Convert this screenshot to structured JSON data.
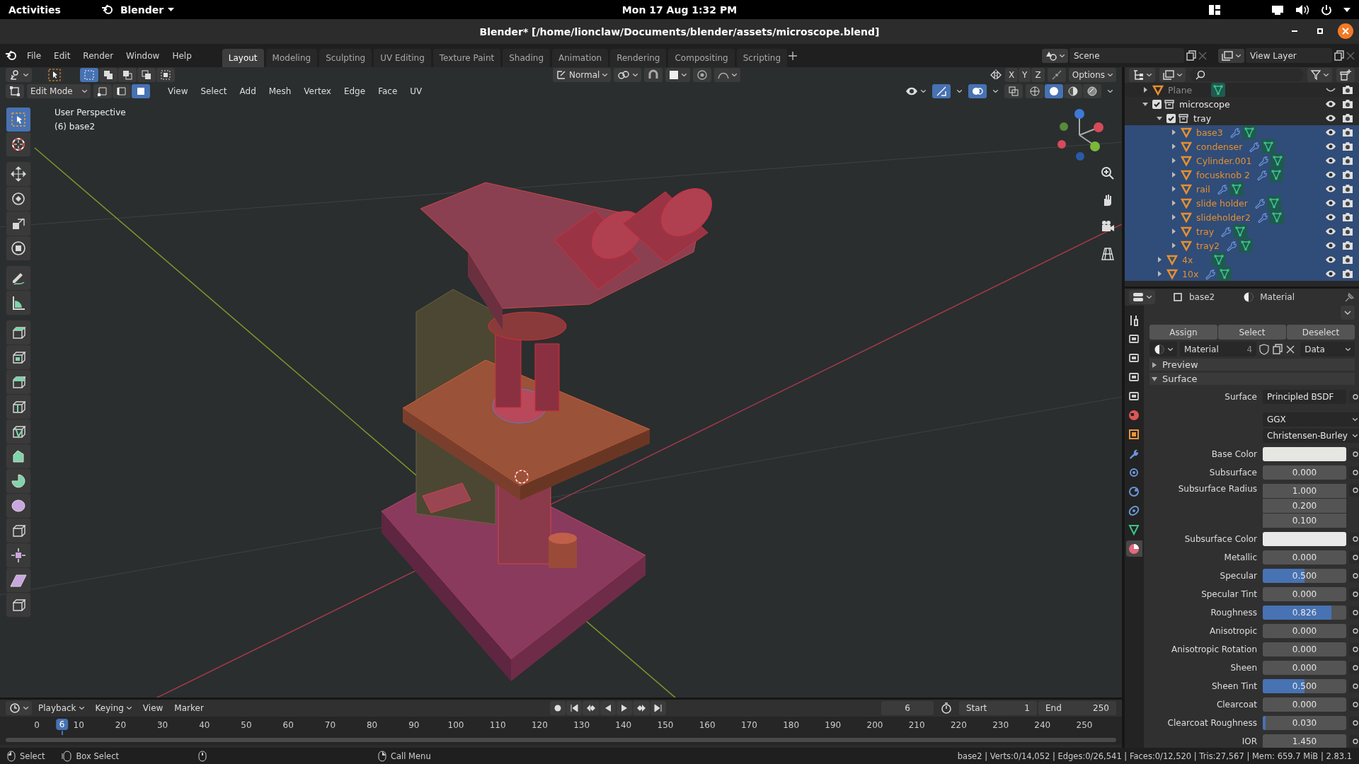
{
  "system_bar": {
    "activities": "Activities",
    "app_menu": "Blender",
    "clock": "Mon 17 Aug  1:32 PM"
  },
  "window": {
    "title": "Blender* [/home/lionclaw/Documents/blender/assets/microscope.blend]"
  },
  "menu": [
    "File",
    "Edit",
    "Render",
    "Window",
    "Help"
  ],
  "workspaces": [
    {
      "label": "Layout",
      "selected": true
    },
    {
      "label": "Modeling",
      "selected": false
    },
    {
      "label": "Sculpting",
      "selected": false
    },
    {
      "label": "UV Editing",
      "selected": false
    },
    {
      "label": "Texture Paint",
      "selected": false
    },
    {
      "label": "Shading",
      "selected": false
    },
    {
      "label": "Animation",
      "selected": false
    },
    {
      "label": "Rendering",
      "selected": false
    },
    {
      "label": "Compositing",
      "selected": false
    },
    {
      "label": "Scripting",
      "selected": false
    }
  ],
  "scene": "Scene",
  "view_layer": "View Layer",
  "viewport": {
    "selection_modes": [
      {
        "kind": "set",
        "selected": true
      },
      {
        "kind": "extend",
        "selected": false
      },
      {
        "kind": "subtract",
        "selected": false
      },
      {
        "kind": "difference",
        "selected": false
      },
      {
        "kind": "intersect",
        "selected": false
      }
    ],
    "orientation": "Normal",
    "mirror_axes": [
      {
        "label": "X",
        "selected": false
      },
      {
        "label": "Y",
        "selected": false
      },
      {
        "label": "Z",
        "selected": false
      }
    ],
    "options": "Options",
    "mode": "Edit Mode",
    "mesh_select_modes": [
      {
        "kind": "vertex",
        "selected": false
      },
      {
        "kind": "edge",
        "selected": false
      },
      {
        "kind": "face",
        "selected": true
      }
    ],
    "menus": [
      "View",
      "Select",
      "Add",
      "Mesh",
      "Vertex",
      "Edge",
      "Face",
      "UV"
    ],
    "shading_modes": [
      {
        "kind": "wireframe",
        "selected": false
      },
      {
        "kind": "solid",
        "selected": true
      },
      {
        "kind": "material",
        "selected": false
      },
      {
        "kind": "rendered",
        "selected": false
      }
    ],
    "view_name": "User Perspective",
    "object_info": "(6) base2",
    "tool_groups": [
      {
        "tools": [
          {
            "kind": "select_box",
            "selected": true
          },
          {
            "kind": "cursor",
            "selected": false
          }
        ]
      },
      {
        "tools": [
          {
            "kind": "move",
            "selected": false
          },
          {
            "kind": "rotate",
            "selected": false
          },
          {
            "kind": "scale",
            "selected": false
          },
          {
            "kind": "transform",
            "selected": false
          }
        ]
      },
      {
        "tools": [
          {
            "kind": "annotate",
            "selected": false
          },
          {
            "kind": "measure",
            "selected": false
          }
        ]
      },
      {
        "tools": [
          {
            "kind": "extrude",
            "selected": false
          },
          {
            "kind": "inset",
            "selected": false
          },
          {
            "kind": "bevel",
            "selected": false
          },
          {
            "kind": "loop_cut",
            "selected": false
          },
          {
            "kind": "knife",
            "selected": false
          },
          {
            "kind": "poly_build",
            "selected": false
          },
          {
            "kind": "spin",
            "selected": false
          },
          {
            "kind": "smooth",
            "selected": false
          },
          {
            "kind": "edge_slide",
            "selected": false
          },
          {
            "kind": "shrink_fatten",
            "selected": false
          },
          {
            "kind": "shear",
            "selected": false
          },
          {
            "kind": "rip",
            "selected": false
          }
        ]
      }
    ]
  },
  "timeline": {
    "menus": [
      "Playback",
      "Keying",
      "View",
      "Marker"
    ],
    "frame": "6",
    "start_label": "Start",
    "start": "1",
    "end_label": "End",
    "end": "250",
    "ticks": [
      "0",
      "10",
      "20",
      "30",
      "40",
      "50",
      "60",
      "70",
      "80",
      "90",
      "100",
      "110",
      "120",
      "130",
      "140",
      "150",
      "160",
      "170",
      "180",
      "190",
      "200",
      "210",
      "220",
      "230",
      "240",
      "250"
    ],
    "playhead": "6"
  },
  "outliner": {
    "items": [
      {
        "name": "Plane",
        "kind": "mesh",
        "expanded": false,
        "selected": false,
        "visible": false,
        "modifier": false
      },
      {
        "name": "microscope",
        "kind": "collection",
        "expanded": true,
        "checked": true,
        "selected": false,
        "visible": true,
        "children": [
          {
            "name": "tray",
            "kind": "collection",
            "expanded": true,
            "checked": true,
            "selected": false,
            "visible": true,
            "children": [
              {
                "name": "base3",
                "kind": "mesh",
                "expanded": false,
                "selected": true,
                "visible": true,
                "modifier": true
              },
              {
                "name": "condenser",
                "kind": "mesh",
                "expanded": false,
                "selected": true,
                "visible": true,
                "modifier": true
              },
              {
                "name": "Cylinder.001",
                "kind": "mesh",
                "expanded": false,
                "selected": true,
                "visible": true,
                "modifier": true
              },
              {
                "name": "focusknob 2",
                "kind": "mesh",
                "expanded": false,
                "selected": true,
                "visible": true,
                "modifier": true
              },
              {
                "name": "rail",
                "kind": "mesh",
                "expanded": false,
                "selected": true,
                "visible": true,
                "modifier": true
              },
              {
                "name": "slide holder",
                "kind": "mesh",
                "expanded": false,
                "selected": true,
                "visible": true,
                "modifier": true
              },
              {
                "name": "slideholder2",
                "kind": "mesh",
                "expanded": false,
                "selected": true,
                "visible": true,
                "modifier": true
              },
              {
                "name": "tray",
                "kind": "mesh",
                "expanded": false,
                "selected": true,
                "visible": true,
                "modifier": true
              },
              {
                "name": "tray2",
                "kind": "mesh",
                "expanded": false,
                "selected": true,
                "visible": true,
                "modifier": true
              }
            ]
          },
          {
            "name": "4x",
            "kind": "mesh",
            "expanded": false,
            "selected": true,
            "visible": true,
            "modifier": false
          },
          {
            "name": "10x",
            "kind": "mesh",
            "expanded": false,
            "selected": true,
            "visible": true,
            "modifier": true
          }
        ]
      }
    ]
  },
  "properties": {
    "object": "base2",
    "context": "Material",
    "tabs": [
      {
        "kind": "tool",
        "selected": false
      },
      {
        "kind": "render",
        "selected": false
      },
      {
        "kind": "output",
        "selected": false
      },
      {
        "kind": "view_layer",
        "selected": false
      },
      {
        "kind": "scene",
        "selected": false
      },
      {
        "kind": "world",
        "selected": false
      },
      {
        "kind": "object",
        "selected": false
      },
      {
        "kind": "modifiers",
        "selected": false
      },
      {
        "kind": "particles",
        "selected": false
      },
      {
        "kind": "physics",
        "selected": false
      },
      {
        "kind": "constraints",
        "selected": false
      },
      {
        "kind": "data",
        "selected": false
      },
      {
        "kind": "material",
        "selected": true
      }
    ],
    "slot_actions": [
      "Assign",
      "Select",
      "Deselect"
    ],
    "material": {
      "name": "Material",
      "users": "4",
      "link": "Data"
    },
    "panels": [
      {
        "label": "Preview",
        "expanded": false
      },
      {
        "label": "Surface",
        "expanded": true
      }
    ],
    "surface_label": "Surface",
    "surface": "Principled BSDF",
    "distribution": "GGX",
    "subsurface_method": "Christensen-Burley",
    "inputs": [
      {
        "label": "Base Color",
        "kind": "color",
        "color": "#e6e6e3"
      },
      {
        "label": "Subsurface",
        "kind": "number",
        "value": "0.000"
      },
      {
        "label": "Subsurface Radius",
        "kind": "vector",
        "values": [
          "1.000",
          "0.200",
          "0.100"
        ]
      },
      {
        "label": "Subsurface Color",
        "kind": "color",
        "color": "#e9e9e9"
      },
      {
        "label": "Metallic",
        "kind": "number",
        "value": "0.000"
      },
      {
        "label": "Specular",
        "kind": "slider",
        "value": "0.500",
        "level": 0.5
      },
      {
        "label": "Specular Tint",
        "kind": "number",
        "value": "0.000"
      },
      {
        "label": "Roughness",
        "kind": "slider",
        "value": "0.826",
        "level": 0.826
      },
      {
        "label": "Anisotropic",
        "kind": "number",
        "value": "0.000"
      },
      {
        "label": "Anisotropic Rotation",
        "kind": "number",
        "value": "0.000"
      },
      {
        "label": "Sheen",
        "kind": "number",
        "value": "0.000"
      },
      {
        "label": "Sheen Tint",
        "kind": "slider",
        "value": "0.500",
        "level": 0.5
      },
      {
        "label": "Clearcoat",
        "kind": "number",
        "value": "0.000"
      },
      {
        "label": "Clearcoat Roughness",
        "kind": "slider",
        "value": "0.030",
        "level": 0.03
      },
      {
        "label": "IOR",
        "kind": "number",
        "value": "1.450"
      }
    ]
  },
  "status_bar": {
    "hints": [
      "Select",
      "Box Select",
      "Call Menu"
    ],
    "stats": "base2 | Verts:0/14,052 | Edges:0/26,541 | Faces:0/12,520 | Tris:27,567 | Mem: 659.7 MiB | 2.83.1"
  }
}
